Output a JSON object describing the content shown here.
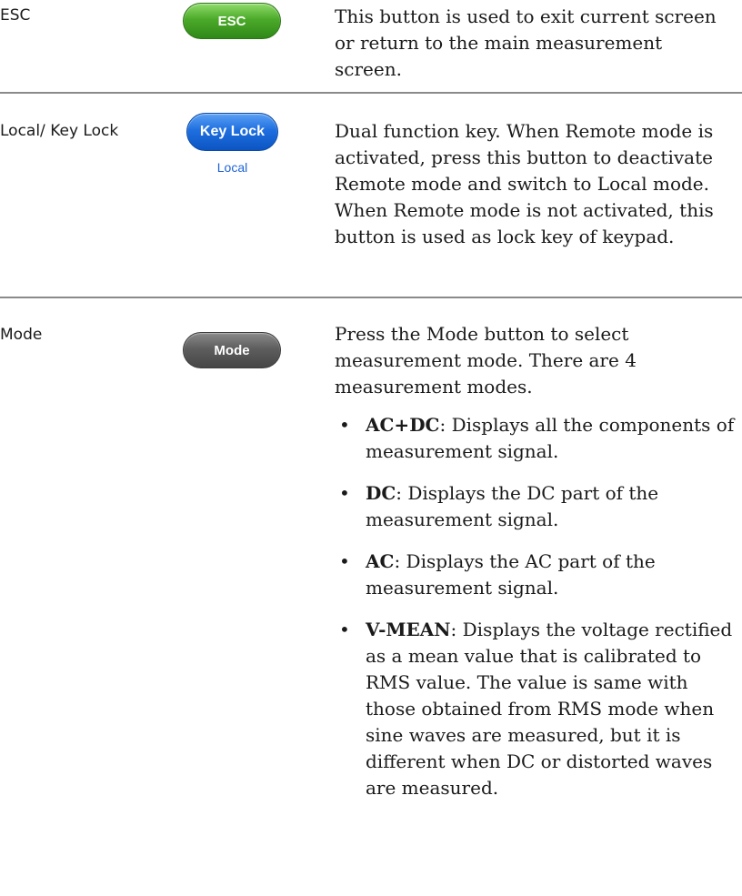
{
  "rows": [
    {
      "name": "ESC",
      "key_label": "ESC",
      "description": "This button is used to exit current screen or return to the main measurement screen."
    },
    {
      "name": "Local/ Key Lock",
      "key_label": "Key Lock",
      "key_sublabel": "Local",
      "description": "Dual function key. When Remote mode is activated, press this button to deactivate Remote mode and switch to Local mode. When Remote mode is not activated, this button is used as lock key of keypad."
    },
    {
      "name": "Mode",
      "key_label": "Mode",
      "description": "Press the Mode button to select measurement mode. There are 4 measurement modes.",
      "modes": [
        {
          "term": "AC+DC",
          "text": ": Displays all the components of measurement signal."
        },
        {
          "term": "DC",
          "text": ": Displays the DC part of the measurement signal."
        },
        {
          "term": "AC",
          "text": ": Displays the AC part of the measurement signal."
        },
        {
          "term": "V-MEAN",
          "text": ": Displays the voltage rectified as a mean value that is calibrated to RMS value. The value is same with those obtained from RMS mode when sine waves are measured, but it is different when DC or distorted waves are measured."
        }
      ]
    }
  ],
  "colors": {
    "esc_key": "#4caa2a",
    "lock_key": "#1f6fe0",
    "local_text": "#1f63d6",
    "mode_key": "#5e5e5e",
    "divider": "#8a8a8a"
  },
  "bullet_glyph": "•"
}
